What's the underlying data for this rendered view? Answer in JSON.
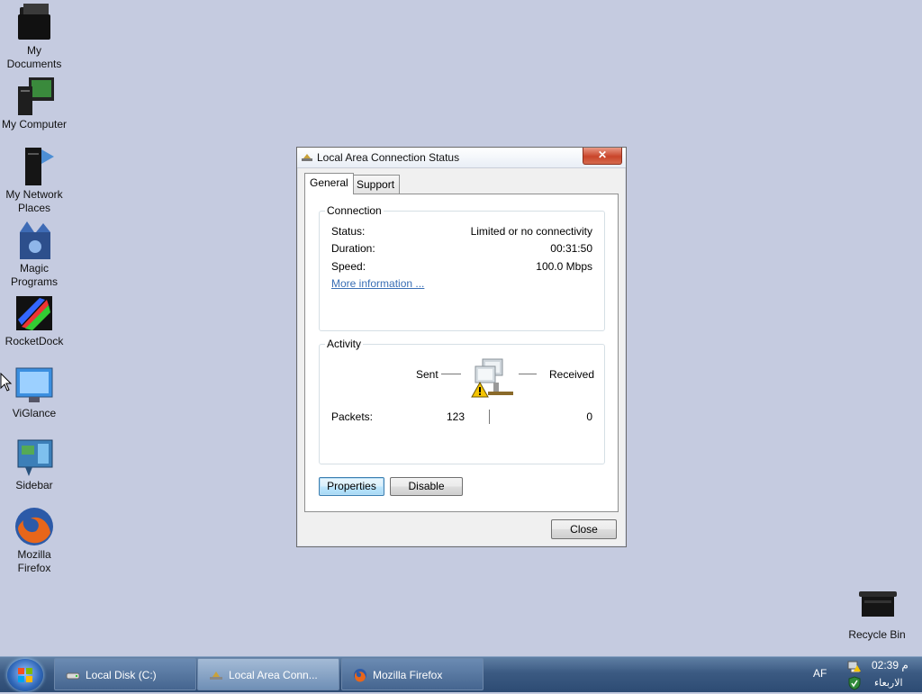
{
  "desktop": {
    "icons": [
      {
        "label": "My Documents",
        "icon": "documents-folder-icon"
      },
      {
        "label": "My Computer",
        "icon": "computer-icon"
      },
      {
        "label": "My Network Places",
        "icon": "network-places-icon"
      },
      {
        "label": "Magic Programs",
        "icon": "magic-programs-icon"
      },
      {
        "label": "RocketDock",
        "icon": "rocketdock-icon"
      },
      {
        "label": "ViGlance",
        "icon": "viglance-icon"
      },
      {
        "label": "Sidebar",
        "icon": "sidebar-icon"
      },
      {
        "label": "Mozilla Firefox",
        "icon": "firefox-icon"
      },
      {
        "label": "Recycle Bin",
        "icon": "recycle-bin-icon"
      }
    ]
  },
  "dialog": {
    "title": "Local Area Connection Status",
    "close_glyph": "✕",
    "tabs": [
      {
        "label": "General",
        "active": true
      },
      {
        "label": "Support",
        "active": false
      }
    ],
    "connection": {
      "title": "Connection",
      "status_label": "Status:",
      "status_value": "Limited or no connectivity",
      "duration_label": "Duration:",
      "duration_value": "00:31:50",
      "speed_label": "Speed:",
      "speed_value": "100.0 Mbps",
      "more_info": "More information ..."
    },
    "activity": {
      "title": "Activity",
      "sent_label": "Sent",
      "received_label": "Received",
      "packets_label": "Packets:",
      "packets_sent": "123",
      "packets_received": "0"
    },
    "buttons": {
      "properties": "Properties",
      "disable": "Disable",
      "close": "Close"
    }
  },
  "taskbar": {
    "tasks": [
      {
        "label": "Local Disk (C:)",
        "icon": "drive-icon",
        "active": false
      },
      {
        "label": "Local Area Conn...",
        "icon": "network-icon",
        "active": true
      },
      {
        "label": "Mozilla Firefox",
        "icon": "firefox-icon",
        "active": false
      }
    ],
    "language": "AF",
    "time": "02:39 م",
    "day": "الاربعاء"
  },
  "colors": {
    "desktop": "#c5cbe0",
    "taskbar": "#3b5a82",
    "link": "#3a6fb5",
    "close_button": "#c9452a"
  }
}
